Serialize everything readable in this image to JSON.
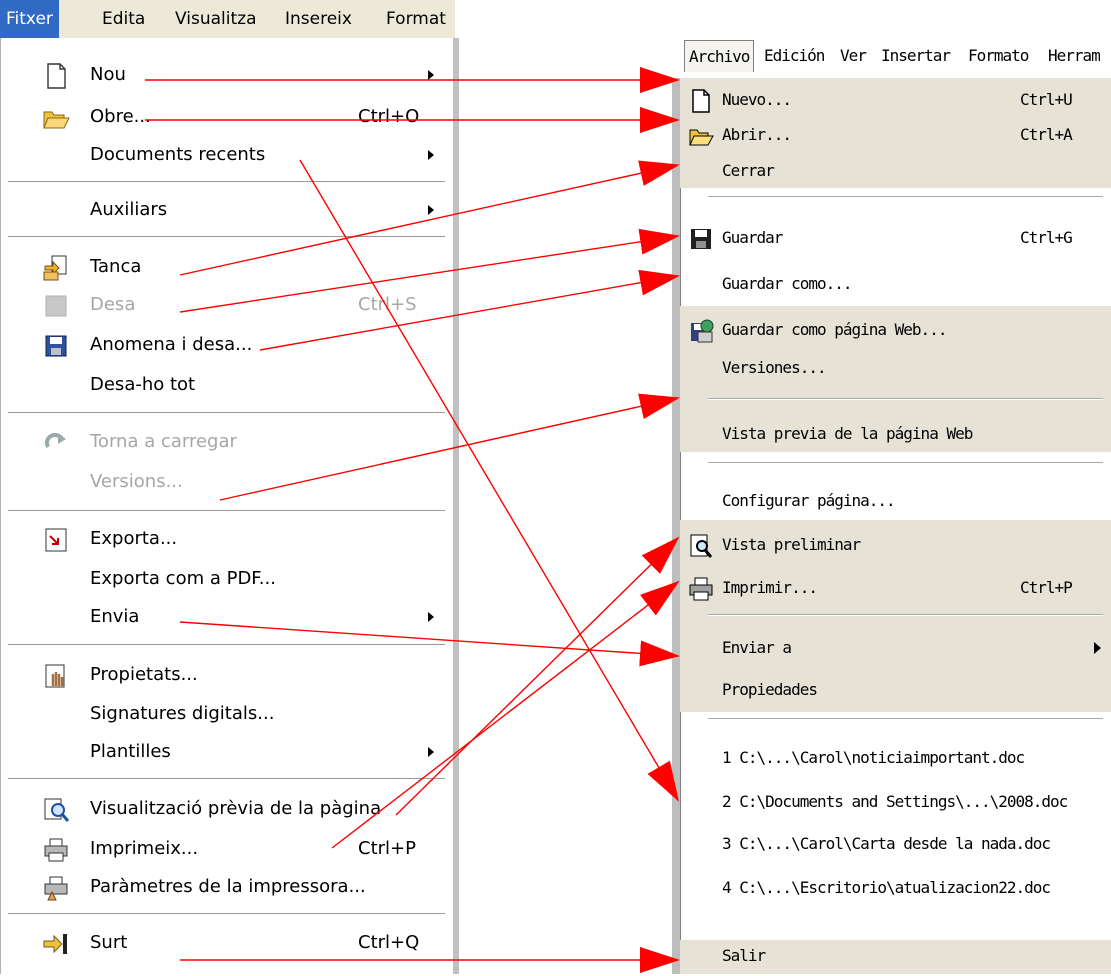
{
  "left_menubar": {
    "items": [
      "Fitxer",
      "Edita",
      "Visualitza",
      "Insereix",
      "Format"
    ]
  },
  "left_menu": {
    "items": [
      {
        "label": "Nou",
        "shortcut": "",
        "submenu": true,
        "icon": "new-document-icon",
        "disabled": false
      },
      {
        "label": "Obre...",
        "shortcut": "Ctrl+O",
        "submenu": false,
        "icon": "open-folder-icon",
        "disabled": false
      },
      {
        "label": "Documents recents",
        "shortcut": "",
        "submenu": true,
        "icon": "",
        "disabled": false
      },
      {
        "label": "Auxiliars",
        "shortcut": "",
        "submenu": true,
        "icon": "",
        "disabled": false
      },
      {
        "label": "Tanca",
        "shortcut": "",
        "submenu": false,
        "icon": "close-document-icon",
        "disabled": false
      },
      {
        "label": "Desa",
        "shortcut": "Ctrl+S",
        "submenu": false,
        "icon": "save-icon",
        "disabled": true
      },
      {
        "label": "Anomena i desa...",
        "shortcut": "",
        "submenu": false,
        "icon": "save-as-icon",
        "disabled": false
      },
      {
        "label": "Desa-ho tot",
        "shortcut": "",
        "submenu": false,
        "icon": "",
        "disabled": false
      },
      {
        "label": "Torna a carregar",
        "shortcut": "",
        "submenu": false,
        "icon": "reload-icon",
        "disabled": true
      },
      {
        "label": "Versions...",
        "shortcut": "",
        "submenu": false,
        "icon": "",
        "disabled": true
      },
      {
        "label": "Exporta...",
        "shortcut": "",
        "submenu": false,
        "icon": "export-icon",
        "disabled": false
      },
      {
        "label": "Exporta com a PDF...",
        "shortcut": "",
        "submenu": false,
        "icon": "",
        "disabled": false
      },
      {
        "label": "Envia",
        "shortcut": "",
        "submenu": true,
        "icon": "",
        "disabled": false
      },
      {
        "label": "Propietats...",
        "shortcut": "",
        "submenu": false,
        "icon": "properties-icon",
        "disabled": false
      },
      {
        "label": "Signatures digitals...",
        "shortcut": "",
        "submenu": false,
        "icon": "",
        "disabled": false
      },
      {
        "label": "Plantilles",
        "shortcut": "",
        "submenu": true,
        "icon": "",
        "disabled": false
      },
      {
        "label": "Visualització prèvia de la pàgina",
        "shortcut": "",
        "submenu": false,
        "icon": "print-preview-icon",
        "disabled": false
      },
      {
        "label": "Imprimeix...",
        "shortcut": "Ctrl+P",
        "submenu": false,
        "icon": "printer-icon",
        "disabled": false
      },
      {
        "label": "Paràmetres de la impressora...",
        "shortcut": "",
        "submenu": false,
        "icon": "printer-settings-icon",
        "disabled": false
      },
      {
        "label": "Surt",
        "shortcut": "Ctrl+Q",
        "submenu": false,
        "icon": "exit-icon",
        "disabled": false
      }
    ]
  },
  "right_menubar": {
    "items": [
      "Archivo",
      "Edición",
      "Ver",
      "Insertar",
      "Formato",
      "Herram"
    ]
  },
  "right_menu": {
    "items": [
      {
        "label": "Nuevo...",
        "shortcut": "Ctrl+U",
        "submenu": false,
        "icon": "new-document-icon"
      },
      {
        "label": "Abrir...",
        "shortcut": "Ctrl+A",
        "submenu": false,
        "icon": "open-folder-icon"
      },
      {
        "label": "Cerrar",
        "shortcut": "",
        "submenu": false,
        "icon": ""
      },
      {
        "label": "Guardar",
        "shortcut": "Ctrl+G",
        "submenu": false,
        "icon": "save-icon"
      },
      {
        "label": "Guardar como...",
        "shortcut": "",
        "submenu": false,
        "icon": ""
      },
      {
        "label": "Guardar como página Web...",
        "shortcut": "",
        "submenu": false,
        "icon": "save-web-icon"
      },
      {
        "label": "Versiones...",
        "shortcut": "",
        "submenu": false,
        "icon": ""
      },
      {
        "label": "Vista previa de la página Web",
        "shortcut": "",
        "submenu": false,
        "icon": ""
      },
      {
        "label": "Configurar página...",
        "shortcut": "",
        "submenu": false,
        "icon": ""
      },
      {
        "label": "Vista preliminar",
        "shortcut": "",
        "submenu": false,
        "icon": "print-preview-icon"
      },
      {
        "label": "Imprimir...",
        "shortcut": "Ctrl+P",
        "submenu": false,
        "icon": "printer-icon"
      },
      {
        "label": "Enviar a",
        "shortcut": "",
        "submenu": true,
        "icon": ""
      },
      {
        "label": "Propiedades",
        "shortcut": "",
        "submenu": false,
        "icon": ""
      },
      {
        "label": "1 C:\\...\\Carol\\noticiaimportant.doc",
        "shortcut": "",
        "submenu": false,
        "icon": ""
      },
      {
        "label": "2 C:\\Documents and Settings\\...\\2008.doc",
        "shortcut": "",
        "submenu": false,
        "icon": ""
      },
      {
        "label": "3 C:\\...\\Carol\\Carta desde la nada.doc",
        "shortcut": "",
        "submenu": false,
        "icon": ""
      },
      {
        "label": "4 C:\\...\\Escritorio\\atualizacion22.doc",
        "shortcut": "",
        "submenu": false,
        "icon": ""
      },
      {
        "label": "Salir",
        "shortcut": "",
        "submenu": false,
        "icon": ""
      }
    ]
  },
  "colors": {
    "arrow": "#ff0000",
    "menu_selected": "#316ac5",
    "menu_bar": "#ece9d8",
    "right_band": "#e6e3d6",
    "disabled_text": "#a6a6a6"
  }
}
